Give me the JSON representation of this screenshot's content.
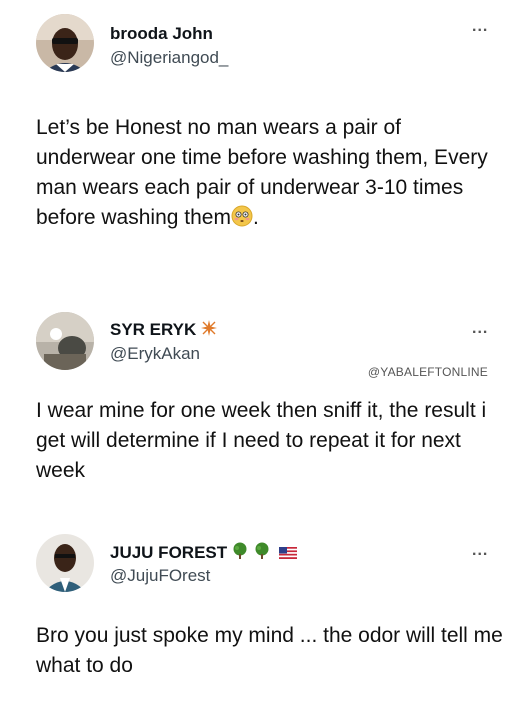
{
  "tweets": [
    {
      "name": "brooda John",
      "handle": "@Nigeriangod_",
      "more": "...",
      "text": "Let’s be Honest no man wears a pair of underwear one time before washing them, Every man wears each pair of underwear 3-10 times before washing them",
      "text_tail": ".",
      "emoji": "flushed-face-icon"
    },
    {
      "name": "SYR ERYK",
      "handle": "@ErykAkan",
      "more": "...",
      "watermark": "@YABALEFTONLINE",
      "text": "I wear mine for one week then sniff it, the result i get will determine if I need to repeat it for next week",
      "badge": "sparkle-icon"
    },
    {
      "name": "JUJU FOREST",
      "handle": "@JujuFOrest",
      "more": "...",
      "text": "Bro you just spoke my mind ... the odor will tell me what to do",
      "badges": [
        "tree-icon",
        "tree-icon",
        "us-flag-icon"
      ]
    }
  ],
  "colors": {
    "text": "#111111",
    "handle": "#404b54",
    "tree_green": "#3f8a2a",
    "sparkle_orange": "#e07a2a"
  }
}
